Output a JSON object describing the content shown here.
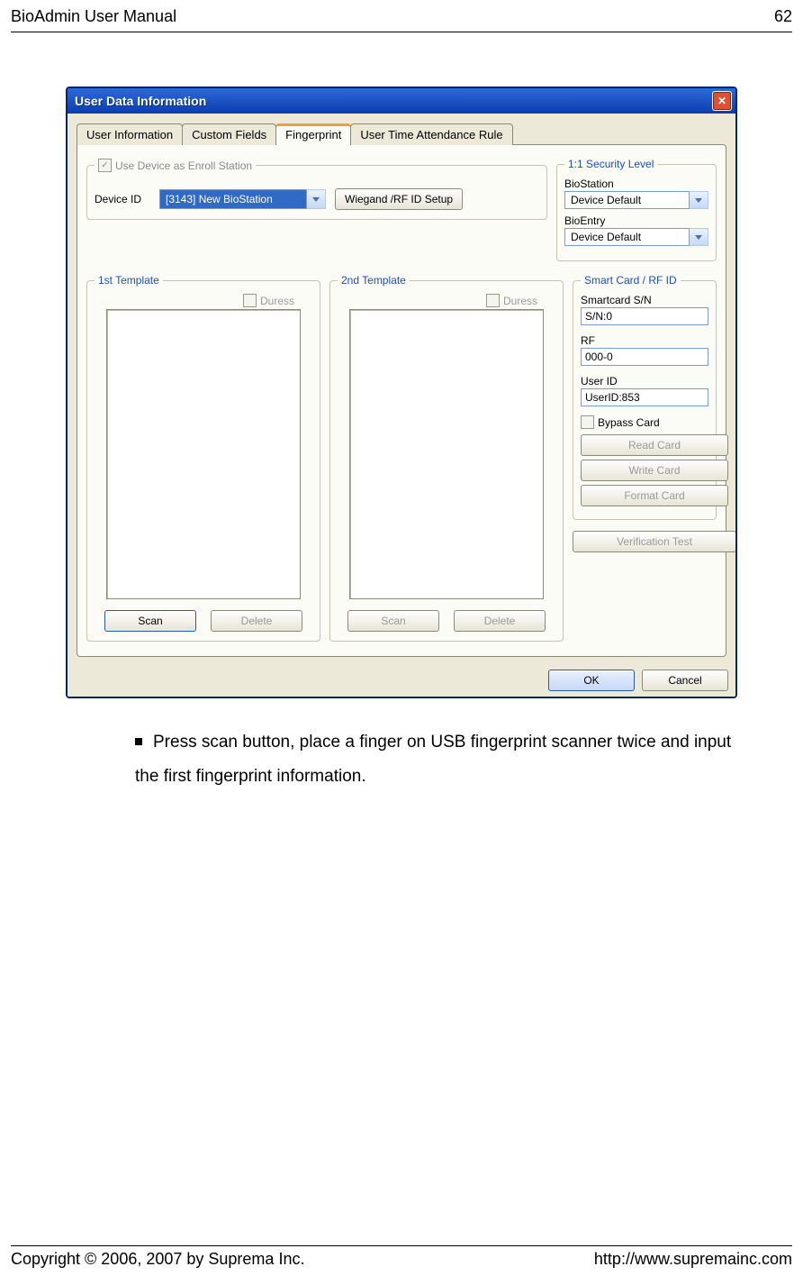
{
  "header": {
    "title": "BioAdmin User Manual",
    "page_num": "62"
  },
  "footer": {
    "copyright": "Copyright © 2006, 2007 by Suprema Inc.",
    "url": "http://www.supremainc.com"
  },
  "instruction_text": "Press scan button, place a finger on USB fingerprint scanner twice and input the first fingerprint information.",
  "dialog": {
    "title": "User Data Information",
    "tabs": {
      "user_info": "User Information",
      "custom_fields": "Custom Fields",
      "fingerprint": "Fingerprint",
      "time_rule": "User Time Attendance Rule"
    },
    "enroll": {
      "legend": "Use Device as Enroll Station",
      "device_id_label": "Device ID",
      "device_id_value": "[3143] New BioStation",
      "wiegand_btn": "Wiegand /RF ID Setup"
    },
    "security": {
      "legend": "1:1 Security Level",
      "biostation_label": "BioStation",
      "biostation_value": "Device Default",
      "bioentry_label": "BioEntry",
      "bioentry_value": "Device Default"
    },
    "tmpl1": {
      "legend": "1st Template",
      "duress": "Duress",
      "scan": "Scan",
      "delete": "Delete"
    },
    "tmpl2": {
      "legend": "2nd Template",
      "duress": "Duress",
      "scan": "Scan",
      "delete": "Delete"
    },
    "smart": {
      "legend": "Smart Card / RF ID",
      "sn_label": "Smartcard S/N",
      "sn_value": "S/N:0",
      "rf_label": "RF",
      "rf_value": "000-0",
      "uid_label": "User ID",
      "uid_value": "UserID:853",
      "bypass": "Bypass Card",
      "read": "Read Card",
      "write": "Write Card",
      "format": "Format Card"
    },
    "verification_test": "Verification Test",
    "ok": "OK",
    "cancel": "Cancel"
  }
}
